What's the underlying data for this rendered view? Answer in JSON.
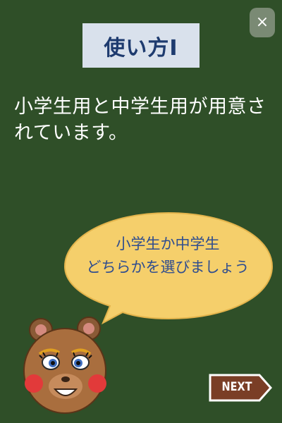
{
  "header": {
    "close_label": "×",
    "title": "使い方Ⅰ"
  },
  "main": {
    "description": "小学生用と中学生用が用意されています。"
  },
  "speech_bubble": {
    "line1": "小学生か中学生",
    "line2": "どちらかを選びましょう"
  },
  "footer": {
    "next_label": "NEXT"
  },
  "icons": {
    "close": "close-icon",
    "mascot": "bear-mascot-icon",
    "next": "next-arrow-sign-icon"
  },
  "colors": {
    "background": "#2f4f28",
    "title_bg": "#d9e1ec",
    "title_text": "#1e3b6f",
    "bubble": "#f5cf6b",
    "bubble_text": "#2f4d8f",
    "next_bg": "#7a3e26"
  }
}
